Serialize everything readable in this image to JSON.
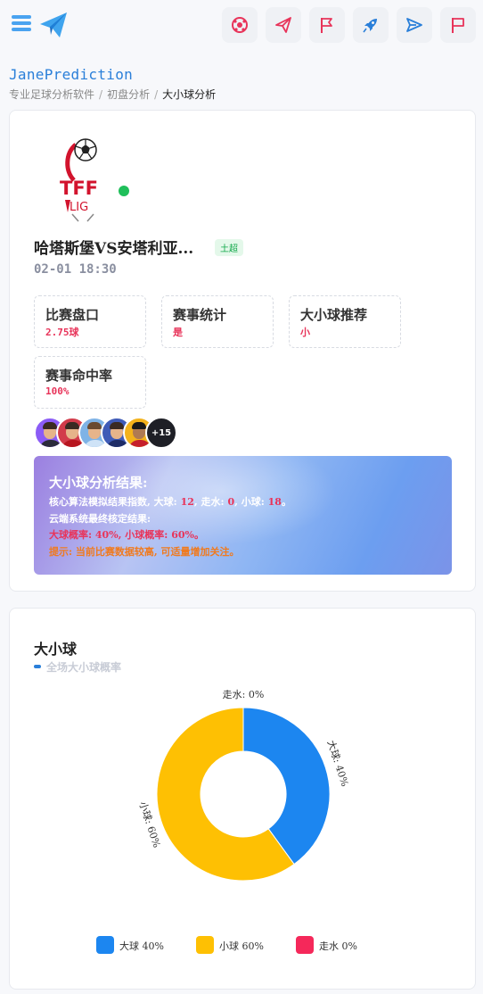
{
  "header": {
    "menu_icon": "hamburger-menu-icon",
    "logo_icon": "paper-plane-logo-icon",
    "action_icons": [
      "soccer-ball-icon",
      "send-icon",
      "flag-icon",
      "rocket-icon",
      "send-arrow-icon",
      "flag-outline-icon"
    ]
  },
  "brand": "JanePrediction",
  "breadcrumb": [
    "专业足球分析软件",
    "初盘分析",
    "大小球分析"
  ],
  "match": {
    "league_logo_text": "TFF",
    "league_logo_subtext": "LIG",
    "title": "哈塔斯堡VS安塔利亚...",
    "league": "土超",
    "time": "02-01 18:30"
  },
  "stats": [
    {
      "label": "比赛盘口",
      "value": "2.75球"
    },
    {
      "label": "赛事统计",
      "value": "是"
    },
    {
      "label": "大小球推荐",
      "value": "小"
    },
    {
      "label": "赛事命中率",
      "value": "100%"
    }
  ],
  "avatars_more": "+15",
  "result": {
    "title": "大小球分析结果:",
    "line1_prefix": "核心算法模拟结果指数, ",
    "line1_big_label": "大球: ",
    "line1_big_value": "12",
    "line1_push_label": ", 走水: ",
    "line1_push_value": "0",
    "line1_small_label": ", 小球: ",
    "line1_small_value": "18",
    "line1_suffix": "。",
    "line2": "云端系统最终核定结果:",
    "line3": "大球概率: 40%, 小球概率: 60%。",
    "line4": "提示: 当前比赛数据较高, 可适量增加关注。"
  },
  "chart": {
    "title": "大小球",
    "subtitle": "全场大小球概率"
  },
  "chart_data": {
    "type": "pie",
    "categories": [
      "大球",
      "小球",
      "走水"
    ],
    "values": [
      40,
      60,
      0
    ],
    "slice_labels": [
      "大球: 40%",
      "小球: 60%",
      "走水: 0%"
    ],
    "legend": [
      "大球 40%",
      "小球 60%",
      "走水 0%"
    ],
    "colors": [
      "#1c86f0",
      "#fec003",
      "#f5285a"
    ],
    "donut": true
  }
}
